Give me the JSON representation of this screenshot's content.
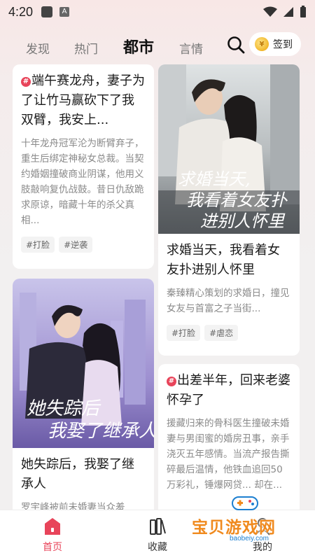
{
  "status_bar": {
    "time": "4:20",
    "a_icon": "A"
  },
  "tabs": [
    {
      "label": "发现",
      "active": false
    },
    {
      "label": "热门",
      "active": false
    },
    {
      "label": "都市",
      "active": true
    },
    {
      "label": "言情",
      "active": false
    }
  ],
  "signin": {
    "label": "签到"
  },
  "cards": {
    "c1": {
      "badge": "#",
      "title": "端午赛龙舟，妻子为了让竹马赢砍下了我双臂，我安上...",
      "desc": "十年龙舟冠军沦为断臂弃子，重生后绑定神秘女总裁。当契约婚姻撞破商业阴谋，他用义肢敲响复仇战鼓。昔日仇敌跪求原谅，暗藏十年的杀父真相...",
      "tags": [
        "#打脸",
        "#逆袭"
      ]
    },
    "c2": {
      "cover_text_1": "求婚当天,",
      "cover_text_2": "我看着女友扑",
      "cover_text_3": "进别人怀里",
      "title": "求婚当天，我看着女友扑进别人怀里",
      "desc": "秦臻精心策划的求婚日，撞见女友与首富之子当街...",
      "tags": [
        "#打脸",
        "#虐恋"
      ]
    },
    "c3": {
      "cover_text_1": "她失踪后",
      "cover_text_2": "我娶了继承人",
      "title": "她失踪后，我娶了继承人",
      "desc": "罗宇峰被前未婚妻当众羞"
    },
    "c4": {
      "badge": "#",
      "title": "出差半年，回来老婆怀孕了",
      "desc": "援藏归来的骨科医生撞破未婚妻与男闺蜜的婚房丑事，亲手浇灭五年感情。当流产报告撕碎最后温情，他铁血追回50万彩礼，锤爆网贷... 却在..."
    }
  },
  "bottom_nav": [
    {
      "label": "首页",
      "active": true
    },
    {
      "label": "收藏",
      "active": false
    },
    {
      "label": "我的",
      "active": false
    }
  ],
  "watermark": {
    "text": "宝贝游戏网",
    "url": "baobeiy.com"
  },
  "colors": {
    "accent": "#e8445a",
    "background": "#f2f0f0"
  }
}
